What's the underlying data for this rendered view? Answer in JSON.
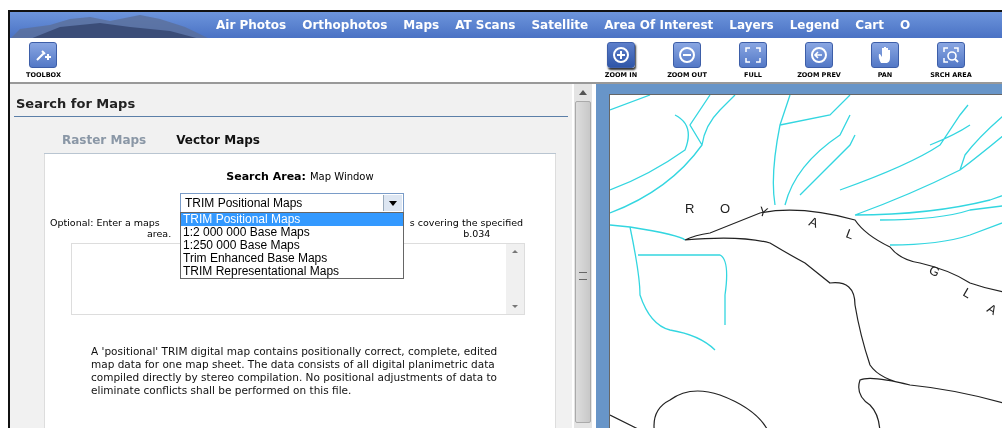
{
  "nav": {
    "items": [
      {
        "label": "Air Photos"
      },
      {
        "label": "Orthophotos"
      },
      {
        "label": "Maps"
      },
      {
        "label": "AT Scans"
      },
      {
        "label": "Satellite"
      },
      {
        "label": "Area Of Interest"
      },
      {
        "label": "Layers"
      },
      {
        "label": "Legend"
      },
      {
        "label": "Cart"
      },
      {
        "label": "O"
      }
    ]
  },
  "toolbox": {
    "label": "TOOLBOX"
  },
  "tools": [
    {
      "kind": "zoomin",
      "label": "ZOOM IN",
      "selected": true
    },
    {
      "kind": "zoomout",
      "label": "ZOOM OUT",
      "selected": false
    },
    {
      "kind": "full",
      "label": "FULL",
      "selected": false
    },
    {
      "kind": "zoomprev",
      "label": "ZOOM PREV",
      "selected": false
    },
    {
      "kind": "pan",
      "label": "PAN",
      "selected": false
    },
    {
      "kind": "srcharea",
      "label": "SRCH AREA",
      "selected": false
    }
  ],
  "panel": {
    "title": "Search for Maps",
    "tabs": [
      {
        "label": "Raster Maps",
        "selected": false
      },
      {
        "label": "Vector Maps",
        "selected": true
      }
    ],
    "search_area": {
      "label": "Search Area:",
      "value": "Map Window"
    },
    "map_type": {
      "value": "TRIM Positional Maps",
      "expanded": true,
      "options": [
        {
          "label": "TRIM Positional Maps",
          "selected": true
        },
        {
          "label": "1:2 000 000 Base Maps",
          "selected": false
        },
        {
          "label": "1:250 000 Base Maps",
          "selected": false
        },
        {
          "label": "Trim Enhanced Base Maps",
          "selected": false
        },
        {
          "label": "TRIM Representational Maps",
          "selected": false
        }
      ]
    },
    "optional_text": {
      "line_1_left": "Optional: Enter a maps",
      "line_1_right": "s covering the specified",
      "line_2_left": "area.",
      "line_2_right": "b.034"
    },
    "description": "A 'positional' TRIM digital map contains positionally correct, complete, edited map data for one map sheet. The data consists of all digital planimetric data compiled directly by stereo compilation. No positional adjustments of data to eliminate conflicts shall be performed on this file."
  },
  "map": {
    "letters": [
      "R",
      "O",
      "Y",
      "A",
      "L",
      "G",
      "L",
      "A"
    ]
  }
}
